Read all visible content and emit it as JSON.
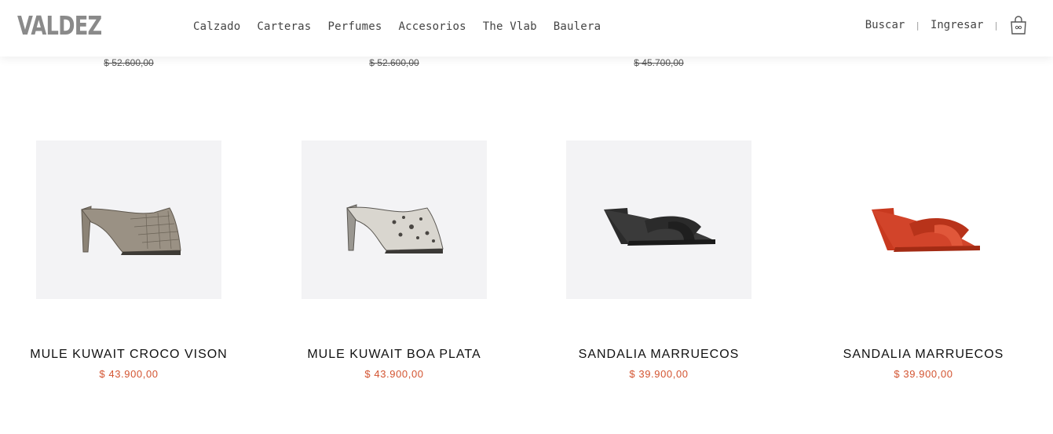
{
  "brand": {
    "logo": "VALDEZ"
  },
  "nav": {
    "items": [
      "Calzado",
      "Carteras",
      "Perfumes",
      "Accesorios",
      "The Vlab",
      "Baulera"
    ]
  },
  "account": {
    "search": "Buscar",
    "separator": "|",
    "login": "Ingresar",
    "cart_icon": "shopping-bag-icon"
  },
  "previous_row": {
    "old_prices": [
      "$ 52.600,00",
      "$ 52.600,00",
      "$ 45.700,00"
    ]
  },
  "products": [
    {
      "name": "MULE KUWAIT CROCO VISON",
      "price": "$ 43.900,00",
      "image_bg": "#f3f3f5",
      "color": "#8c8376"
    },
    {
      "name": "MULE KUWAIT BOA PLATA",
      "price": "$ 43.900,00",
      "image_bg": "#f3f3f5",
      "color": "#b8b4ad"
    },
    {
      "name": "SANDALIA MARRUECOS",
      "price": "$ 39.900,00",
      "image_bg": "#f3f3f5",
      "color": "#2b2b2b"
    },
    {
      "name": "SANDALIA MARRUECOS",
      "price": "$ 39.900,00",
      "image_bg": "#ffffff",
      "color": "#d2442a"
    }
  ],
  "colors": {
    "price": "#d35431",
    "nav_text": "#444444",
    "logo": "#8a8a8a"
  }
}
